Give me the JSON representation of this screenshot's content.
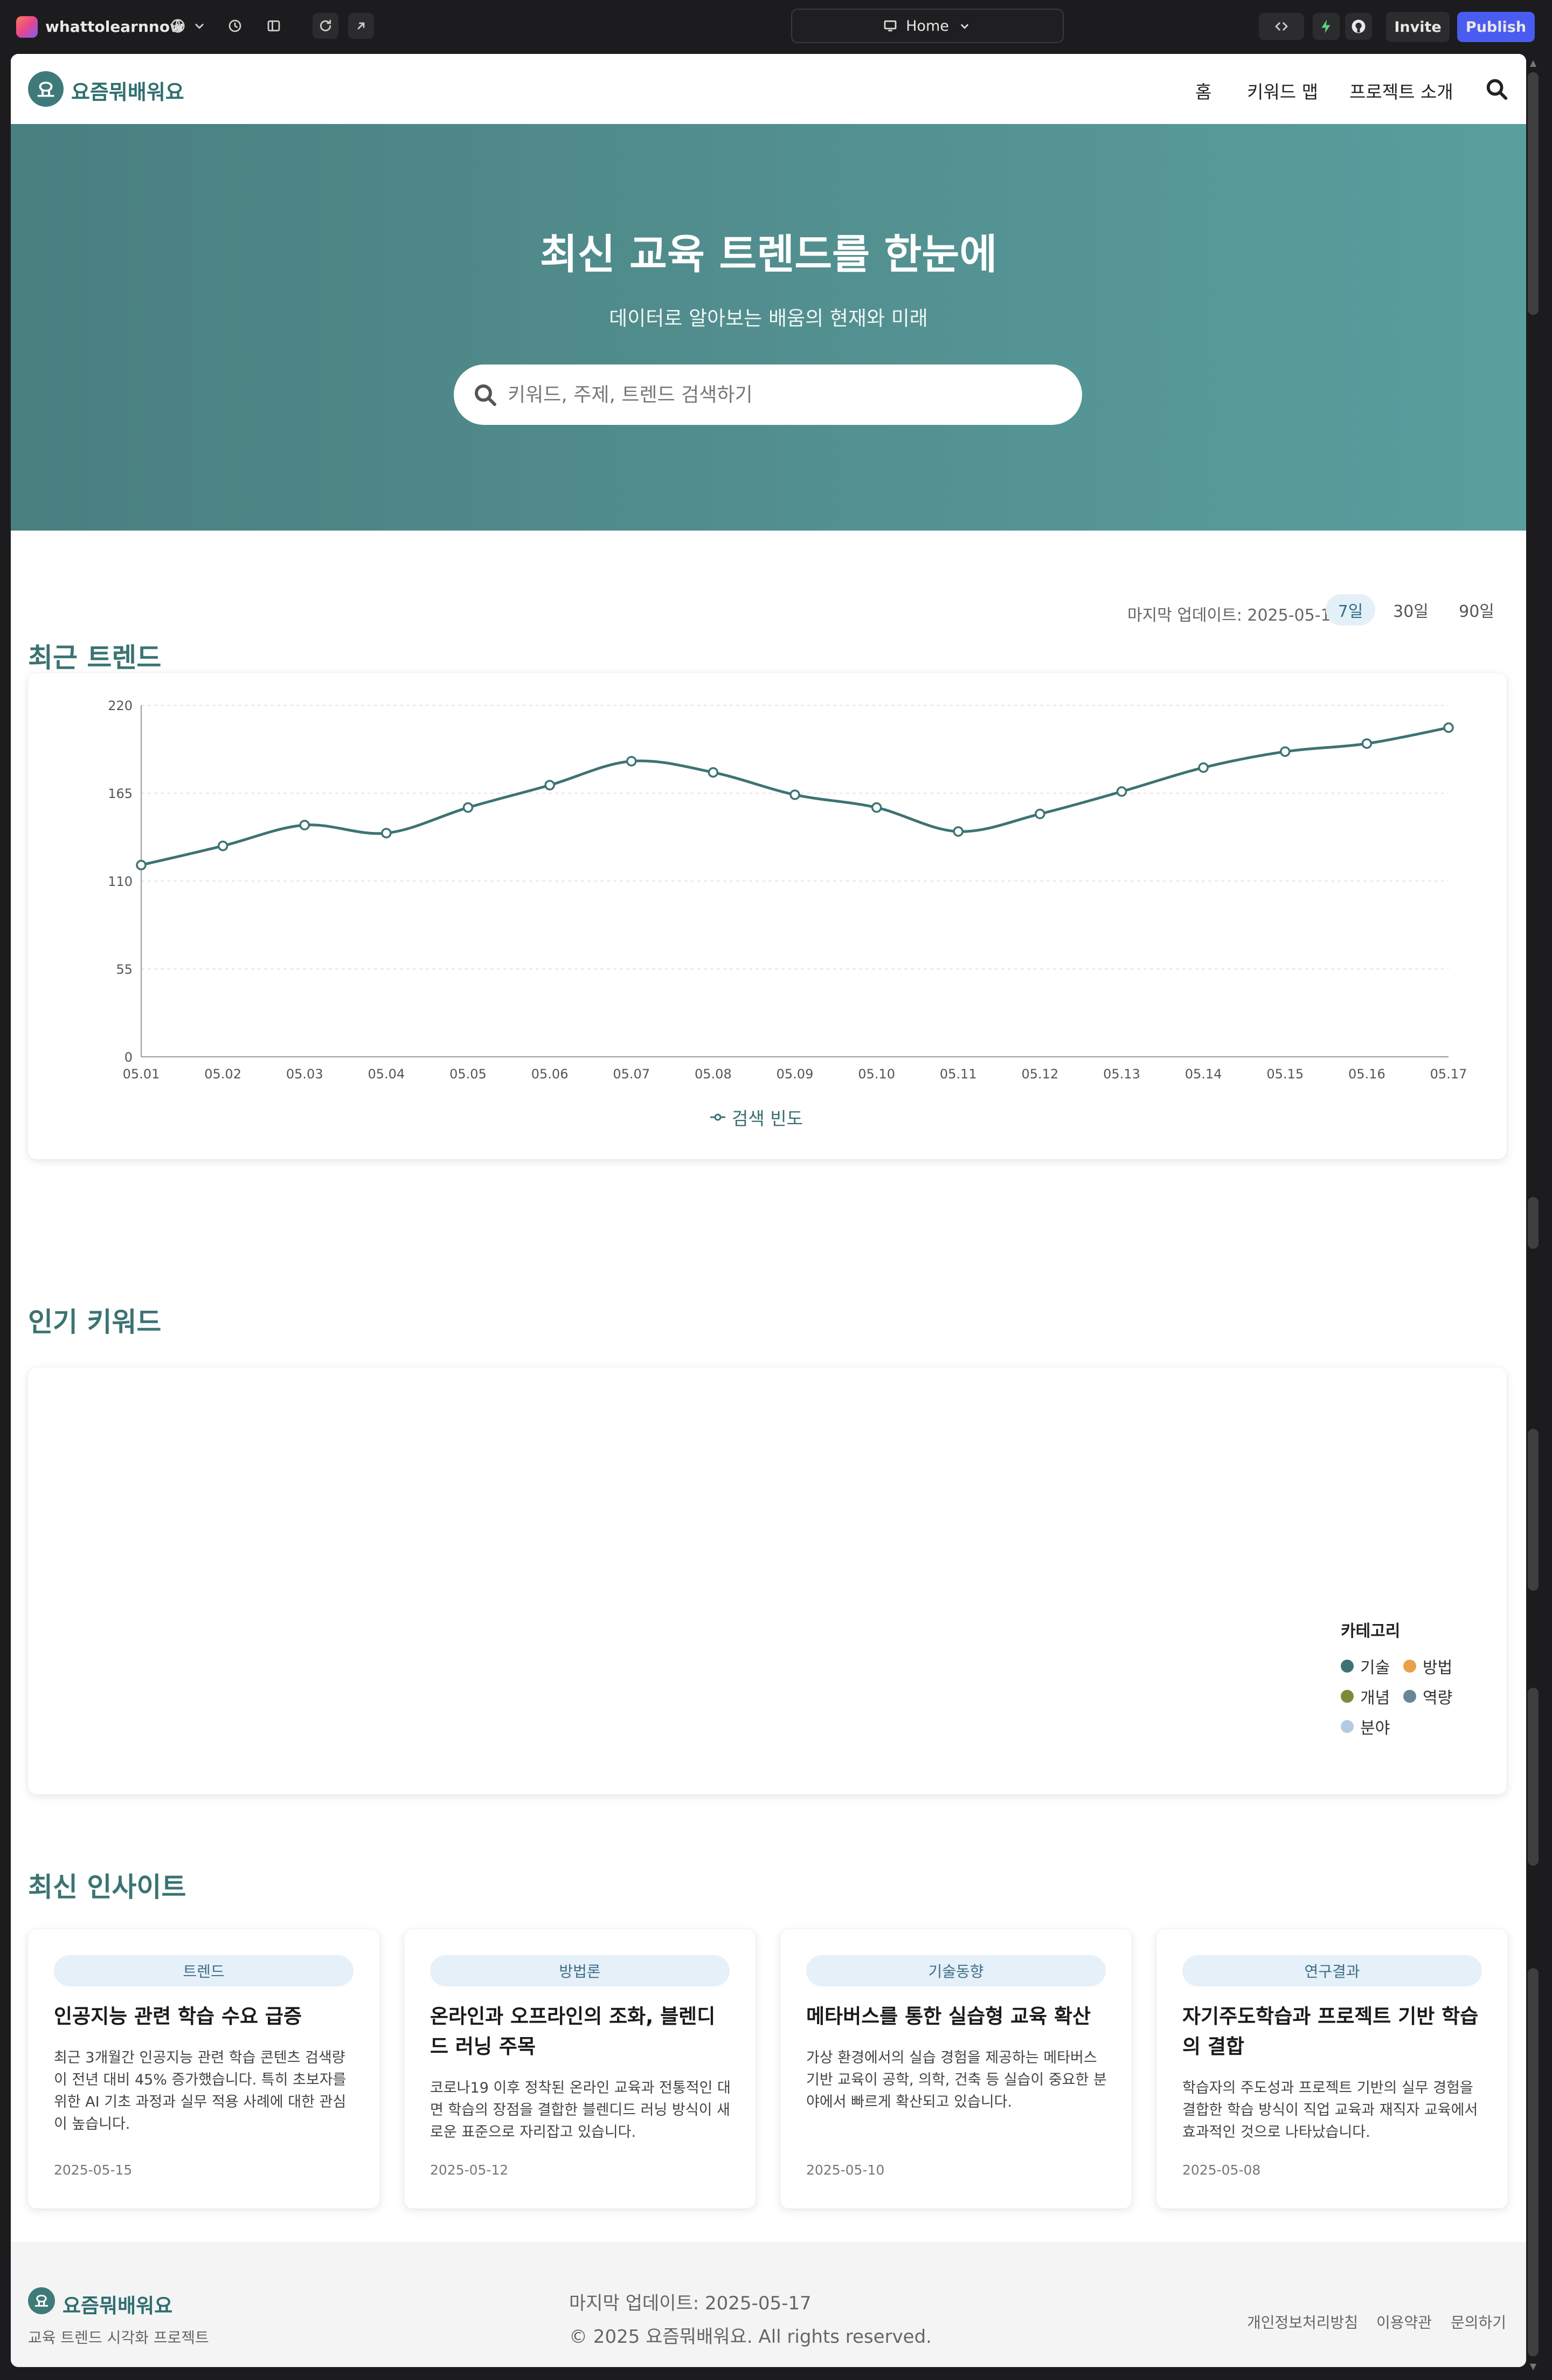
{
  "editor": {
    "project_name": "whattolearnnow",
    "page_selector": "Home",
    "invite_label": "Invite",
    "publish_label": "Publish"
  },
  "site": {
    "logo_char": "요",
    "name": "요즘뭐배워요",
    "nav": [
      "홈",
      "키워드 맵",
      "프로젝트 소개"
    ]
  },
  "hero": {
    "title": "최신 교육 트렌드를 한눈에",
    "subtitle": "데이터로 알아보는 배움의 현재와 미래",
    "search_placeholder": "키워드, 주제, 트렌드 검색하기"
  },
  "trends": {
    "title": "최근 트렌드",
    "updated": "마지막 업데이트: 2025-05-17",
    "ranges": [
      "7일",
      "30일",
      "90일"
    ],
    "active_range": "7일"
  },
  "chart_data": {
    "type": "line",
    "categories": [
      "05.01",
      "05.02",
      "05.03",
      "05.04",
      "05.05",
      "05.06",
      "05.07",
      "05.08",
      "05.09",
      "05.10",
      "05.11",
      "05.12",
      "05.13",
      "05.14",
      "05.15",
      "05.16",
      "05.17"
    ],
    "series": [
      {
        "name": "검색 빈도",
        "values": [
          120,
          132,
          145,
          140,
          156,
          170,
          185,
          178,
          164,
          156,
          141,
          152,
          166,
          181,
          191,
          196,
          206
        ],
        "color": "#3d7373"
      }
    ],
    "yticks": [
      0,
      55,
      110,
      165,
      220
    ],
    "ylim": [
      0,
      220
    ],
    "grid": true,
    "legend": "bottom-center"
  },
  "keywords": {
    "title": "인기 키워드",
    "legend_title": "카테고리",
    "categories": [
      {
        "label": "기술",
        "color": "#3d7373"
      },
      {
        "label": "방법",
        "color": "#e9a04a"
      },
      {
        "label": "개념",
        "color": "#7a8c3a"
      },
      {
        "label": "역량",
        "color": "#6c8596"
      },
      {
        "label": "분야",
        "color": "#b2cbe0"
      }
    ]
  },
  "insights": {
    "title": "최신 인사이트",
    "cards": [
      {
        "badge": "트렌드",
        "title": "인공지능 관련 학습 수요 급증",
        "body": "최근 3개월간 인공지능 관련 학습 콘텐츠 검색량이 전년 대비 45% 증가했습니다. 특히 초보자를 위한 AI 기초 과정과 실무 적용 사례에 대한 관심이 높습니다.",
        "date": "2025-05-15"
      },
      {
        "badge": "방법론",
        "title": "온라인과 오프라인의 조화, 블렌디드 러닝 주목",
        "body": "코로나19 이후 정착된 온라인 교육과 전통적인 대면 학습의 장점을 결합한 블렌디드 러닝 방식이 새로운 표준으로 자리잡고 있습니다.",
        "date": "2025-05-12"
      },
      {
        "badge": "기술동향",
        "title": "메타버스를 통한 실습형 교육 확산",
        "body": "가상 환경에서의 실습 경험을 제공하는 메타버스 기반 교육이 공학, 의학, 건축 등 실습이 중요한 분야에서 빠르게 확산되고 있습니다.",
        "date": "2025-05-10"
      },
      {
        "badge": "연구결과",
        "title": "자기주도학습과 프로젝트 기반 학습의 결합",
        "body": "학습자의 주도성과 프로젝트 기반의 실무 경험을 결합한 학습 방식이 직업 교육과 재직자 교육에서 효과적인 것으로 나타났습니다.",
        "date": "2025-05-08"
      }
    ]
  },
  "footer": {
    "logo_char": "요",
    "name": "요즘뭐배워요",
    "desc": "교육 트렌드 시각화 프로젝트",
    "updated": "마지막 업데이트: 2025-05-17",
    "copyright": "© 2025 요즘뭐배워요. All rights reserved.",
    "links": [
      "개인정보처리방침",
      "이용약관",
      "문의하기"
    ]
  }
}
